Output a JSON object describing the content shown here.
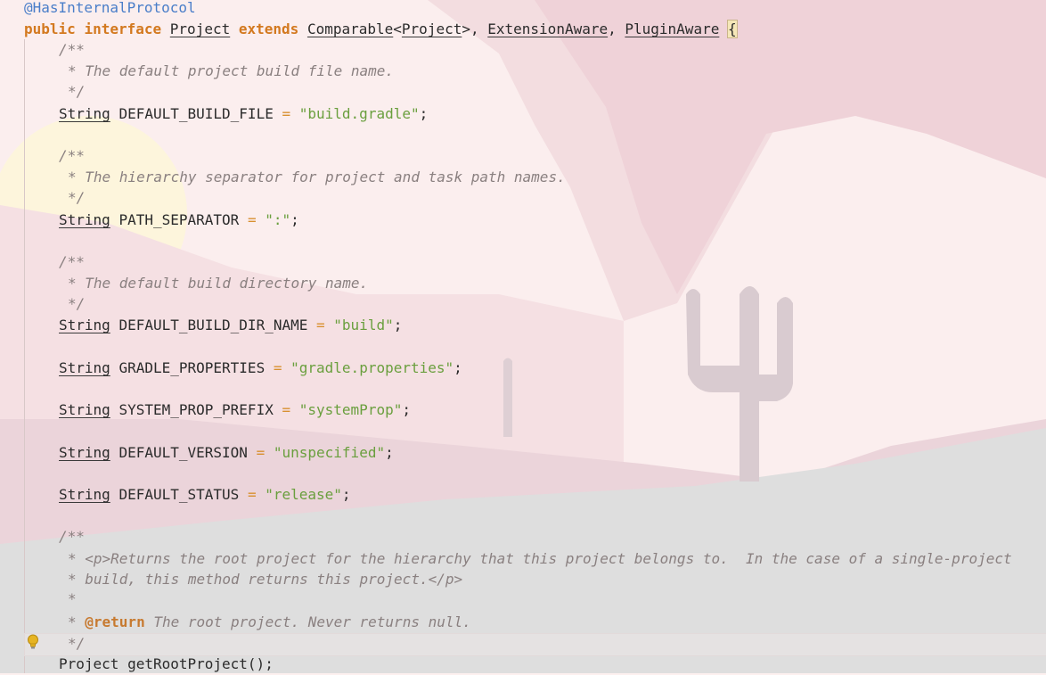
{
  "code": {
    "annotation": "@HasInternalProtocol",
    "decl": {
      "public": "public",
      "interface": "interface",
      "name": "Project",
      "extends": "extends",
      "comparable": "Comparable",
      "generic": "Project",
      "ext1": "ExtensionAware",
      "ext2": "PluginAware",
      "brace": "{"
    },
    "comment_open": "/**",
    "comment_close": "*/",
    "c1": "* The default project build file name.",
    "c2": "* The hierarchy separator for project and task path names.",
    "c3": "* The default build directory name.",
    "type": "String",
    "fields": [
      {
        "name": "DEFAULT_BUILD_FILE",
        "value": "\"build.gradle\""
      },
      {
        "name": "PATH_SEPARATOR",
        "value": "\":\""
      },
      {
        "name": "DEFAULT_BUILD_DIR_NAME",
        "value": "\"build\""
      },
      {
        "name": "GRADLE_PROPERTIES",
        "value": "\"gradle.properties\""
      },
      {
        "name": "SYSTEM_PROP_PREFIX",
        "value": "\"systemProp\""
      },
      {
        "name": "DEFAULT_VERSION",
        "value": "\"unspecified\""
      },
      {
        "name": "DEFAULT_STATUS",
        "value": "\"release\""
      }
    ],
    "doc1": "* <p>Returns the root project for the hierarchy that this project belongs to.  In the case of a single-project",
    "doc2": "* build, this method returns this project.</p>",
    "doc3": "*",
    "doc4_star": "* ",
    "doc4_tag": "@return",
    "doc4_text": " The root project. Never returns null.",
    "method": "Project getRootProject();"
  },
  "icons": {
    "bulb": "intention-bulb-icon"
  },
  "colors": {
    "keyword": "#d3791f",
    "string": "#6a9f3e",
    "annotation": "#4a7ec9",
    "comment": "#8a8080"
  }
}
